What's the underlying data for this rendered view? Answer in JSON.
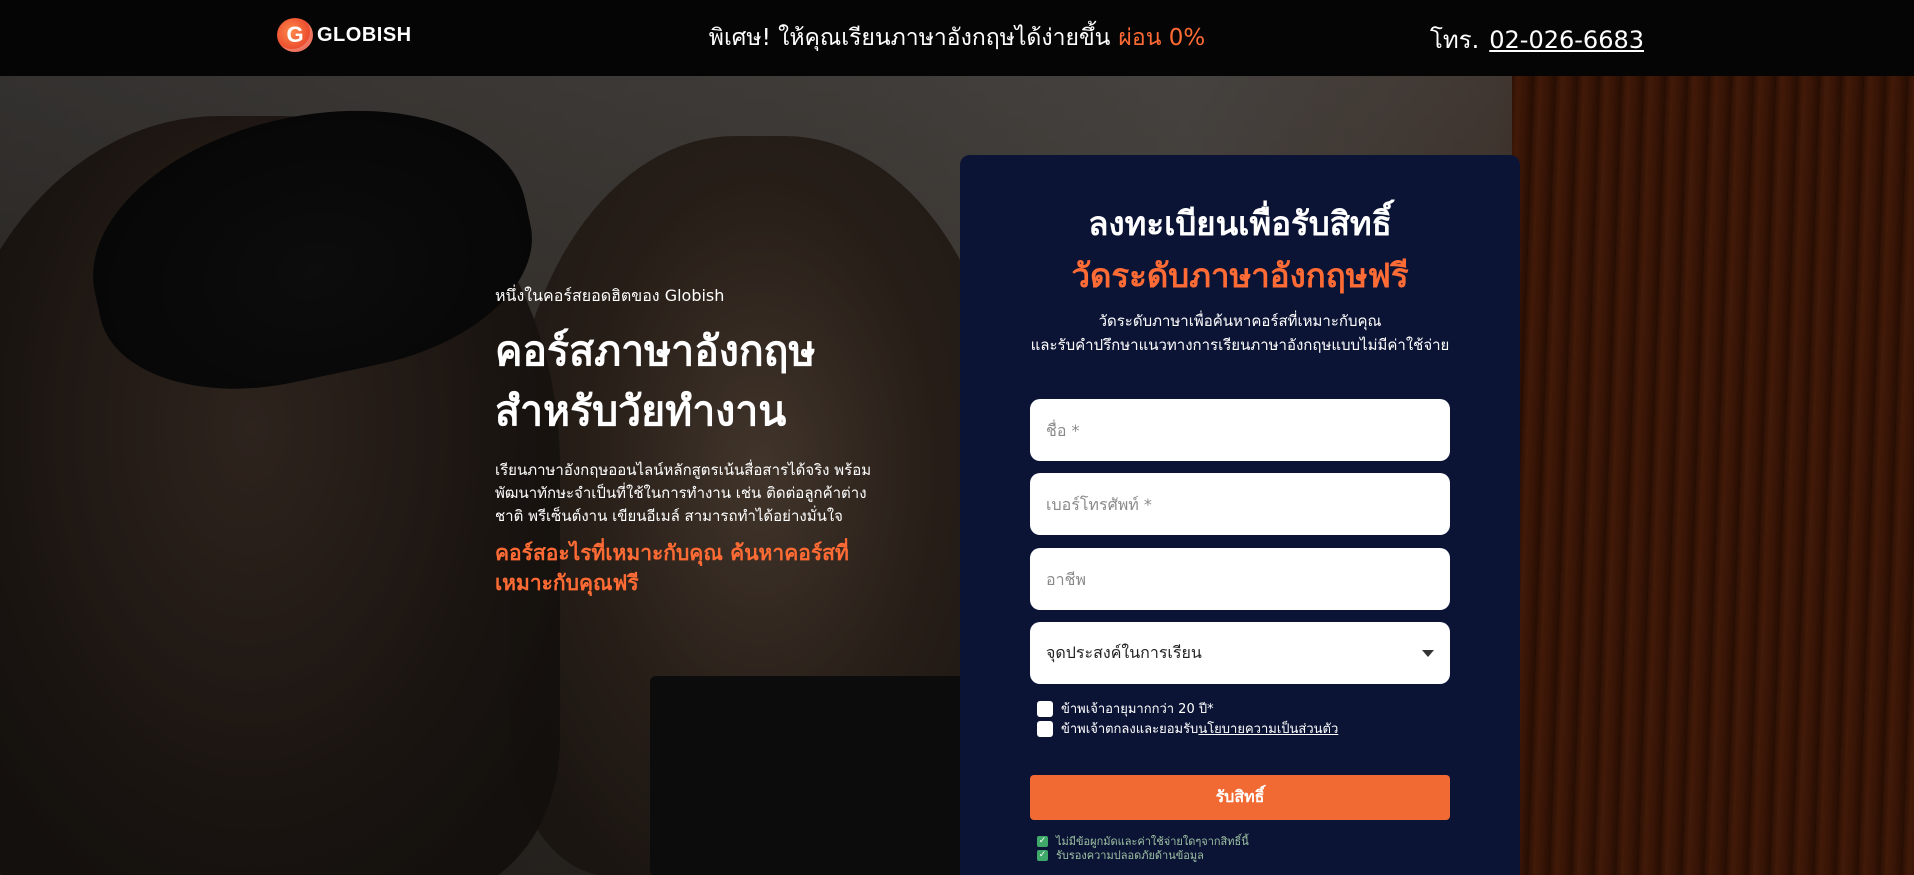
{
  "header": {
    "logo_letter": "G",
    "logo_text": "GLOBISH",
    "promo_text": "พิเศษ! ให้คุณเรียนภาษาอังกฤษได้ง่ายขึ้น",
    "promo_accent": "ผ่อน 0%",
    "phone_label": "โทร.",
    "phone_number": "02-026-6683"
  },
  "hero": {
    "kicker": "หนึ่งในคอร์สยอดฮิตของ Globish",
    "title_line1": "คอร์สภาษาอังกฤษ",
    "title_line2": "สำหรับวัยทำงาน",
    "description": "เรียนภาษาอังกฤษออนไลน์หลักสูตรเน้นสื่อสารได้จริง พร้อมพัฒนาทักษะจำเป็นที่ใช้ในการทำงาน เช่น ติดต่อลูกค้าต่างชาติ พรีเซ็นต์งาน เขียนอีเมล์ สามารถทำได้อย่างมั่นใจ",
    "cta": "คอร์สอะไรที่เหมาะกับคุณ ค้นหาคอร์สที่เหมาะกับคุณฟรี"
  },
  "form": {
    "title": "ลงทะเบียนเพื่อรับสิทธิ์",
    "title_accent": "วัดระดับภาษาอังกฤษฟรี",
    "subtitle_line1": "วัดระดับภาษาเพื่อค้นหาคอร์สที่เหมาะกับคุณ",
    "subtitle_line2": "และรับคำปรึกษาแนวทางการเรียนภาษาอังกฤษแบบไม่มีค่าใช้จ่าย",
    "name_placeholder": "ชื่อ *",
    "phone_placeholder": "เบอร์โทรศัพท์ *",
    "occupation_placeholder": "อาชีพ",
    "purpose_select": "จุดประสงค์ในการเรียน",
    "age_check": "ข้าพเจ้าอายุมากกว่า 20 ปี*",
    "privacy_check_prefix": "ข้าพเจ้าตกลงและยอมรับ",
    "privacy_link": "นโยบายความเป็นส่วนตัว",
    "submit_label": "รับสิทธิ์",
    "assurance_1": "ไม่มีข้อผูกมัดและค่าใช้จ่ายใดๆจากสิทธิ์นี้",
    "assurance_2": "รับรองความปลอดภัยด้านข้อมูล"
  },
  "colors": {
    "accent": "#ff6b35",
    "card_bg": "#0c1436",
    "topbar_bg": "#050505"
  }
}
